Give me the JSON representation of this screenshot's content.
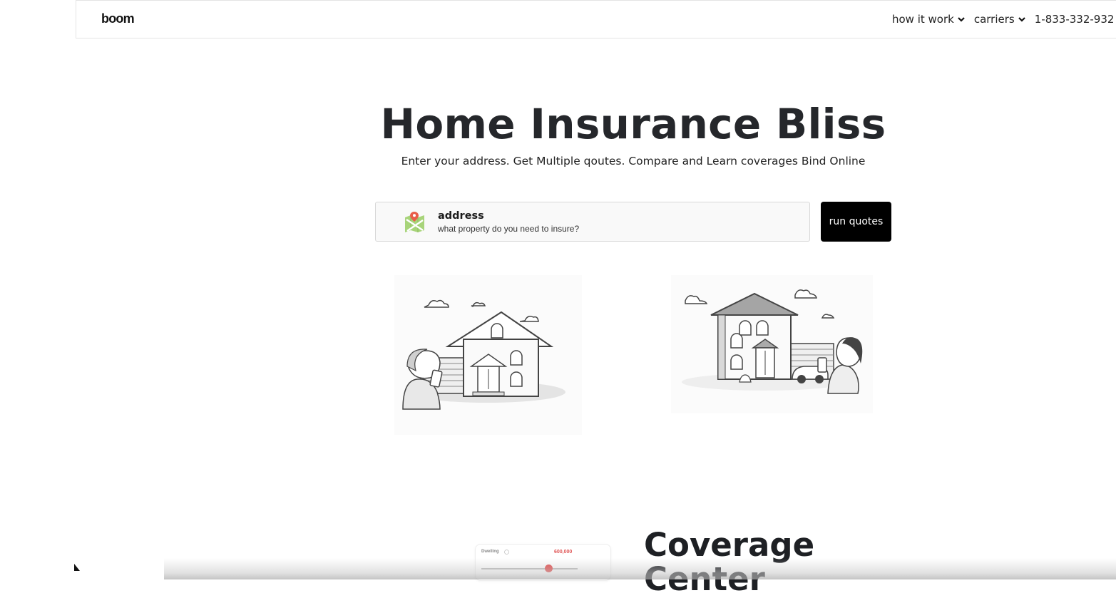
{
  "nav": {
    "logo": "boom",
    "items": [
      {
        "label": "how it work"
      },
      {
        "label": "carriers"
      }
    ],
    "phone": "1-833-332-932"
  },
  "hero": {
    "title": "Home Insurance Bliss",
    "subtitle": "Enter your address. Get Multiple qoutes. Compare and Learn coverages Bind Online"
  },
  "search": {
    "label": "address",
    "placeholder": "what property do you need to insure?",
    "button_label": "run quotes"
  },
  "coverage": {
    "slider_label": "Dwelling",
    "slider_value": "600,000",
    "slider_fraction": 0.7,
    "title": "Coverage Center"
  },
  "colors": {
    "accent": "#e24b4b",
    "button_bg": "#000000",
    "text_dark": "#25272b"
  },
  "icons": [
    "map-pin-icon",
    "chevron-down-icon",
    "info-icon"
  ]
}
